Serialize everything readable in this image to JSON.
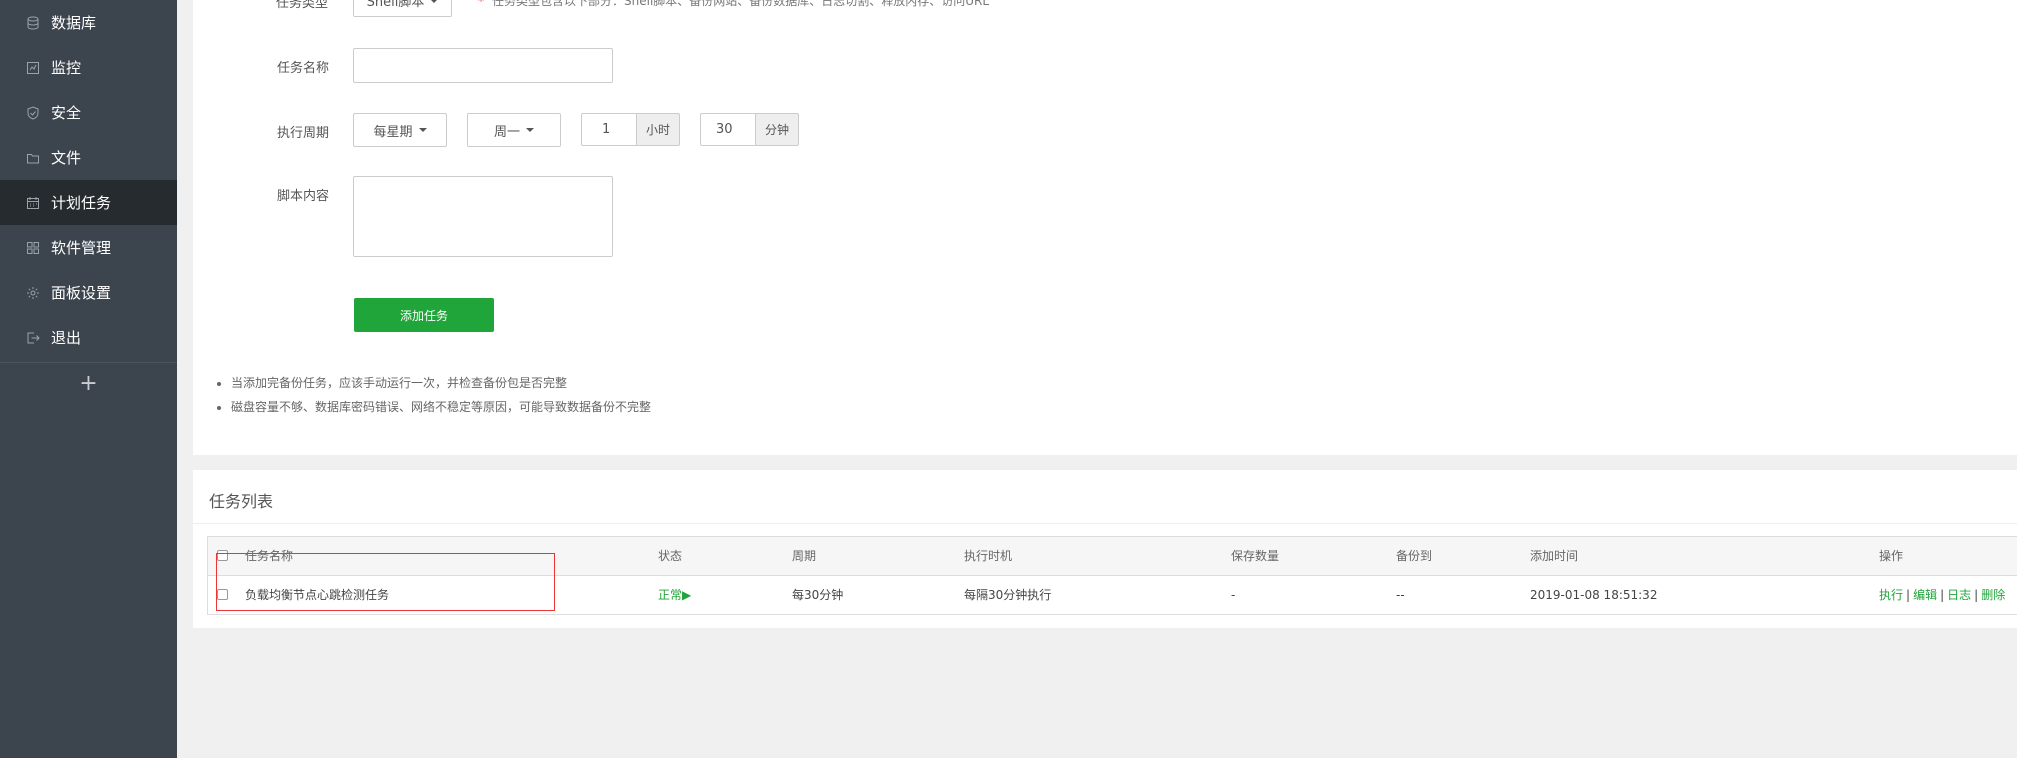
{
  "sidebar": {
    "items": [
      {
        "label": "数据库",
        "icon": "database-icon"
      },
      {
        "label": "监控",
        "icon": "monitor-icon"
      },
      {
        "label": "安全",
        "icon": "shield-icon"
      },
      {
        "label": "文件",
        "icon": "folder-icon"
      },
      {
        "label": "计划任务",
        "icon": "calendar-icon",
        "active": true
      },
      {
        "label": "软件管理",
        "icon": "grid-icon"
      },
      {
        "label": "面板设置",
        "icon": "gear-icon"
      },
      {
        "label": "退出",
        "icon": "logout-icon"
      }
    ],
    "add_label": "+"
  },
  "form": {
    "task_type_label": "任务类型",
    "task_type_value": "Shell脚本",
    "task_type_hint": "任务类型包含以下部分：Shell脚本、备份网站、备份数据库、日志切割、释放内存、访问URL",
    "task_name_label": "任务名称",
    "task_name_value": "",
    "cycle_label": "执行周期",
    "cycle_type": "每星期",
    "weekday": "周一",
    "hour_value": "1",
    "hour_unit": "小时",
    "minute_value": "30",
    "minute_unit": "分钟",
    "script_label": "脚本内容",
    "script_value": "",
    "submit_label": "添加任务"
  },
  "tips": [
    "当添加完备份任务，应该手动运行一次，并检查备份包是否完整",
    "磁盘容量不够、数据库密码错误、网络不稳定等原因，可能导致数据备份不完整"
  ],
  "task_list": {
    "title": "任务列表",
    "columns": [
      "任务名称",
      "状态",
      "周期",
      "执行时机",
      "保存数量",
      "备份到",
      "添加时间",
      "操作"
    ],
    "rows": [
      {
        "name": "负载均衡节点心跳检测任务",
        "status": "正常▶",
        "cycle": "每30分钟",
        "timing": "每隔30分钟执行",
        "save_count": "-",
        "backup_to": "--",
        "added": "2019-01-08 18:51:32",
        "actions": [
          "执行",
          "编辑",
          "日志",
          "删除"
        ]
      }
    ]
  },
  "colors": {
    "sidebar_bg": "#3c444d",
    "sidebar_active": "#262b30",
    "accent_green": "#20a53a",
    "highlight_red": "#e33333"
  }
}
